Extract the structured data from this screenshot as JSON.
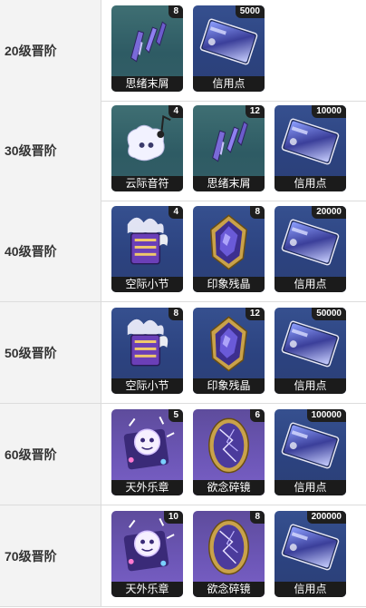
{
  "rows": [
    {
      "label": "20级晋阶",
      "items": [
        {
          "name": "思绪末屑",
          "count": "8",
          "icon": "thought-shard-icon",
          "bg": "green"
        },
        {
          "name": "信用点",
          "count": "5000",
          "icon": "credit-card-icon",
          "bg": "blue"
        }
      ]
    },
    {
      "label": "30级晋阶",
      "items": [
        {
          "name": "云际音符",
          "count": "4",
          "icon": "cloud-note-icon",
          "bg": "green"
        },
        {
          "name": "思绪末屑",
          "count": "12",
          "icon": "thought-shard-icon",
          "bg": "green"
        },
        {
          "name": "信用点",
          "count": "10000",
          "icon": "credit-card-icon",
          "bg": "blue"
        }
      ]
    },
    {
      "label": "40级晋阶",
      "items": [
        {
          "name": "空际小节",
          "count": "4",
          "icon": "sky-measure-icon",
          "bg": "blue"
        },
        {
          "name": "印象残晶",
          "count": "8",
          "icon": "impression-crystal-icon",
          "bg": "blue"
        },
        {
          "name": "信用点",
          "count": "20000",
          "icon": "credit-card-icon",
          "bg": "blue"
        }
      ]
    },
    {
      "label": "50级晋阶",
      "items": [
        {
          "name": "空际小节",
          "count": "8",
          "icon": "sky-measure-icon",
          "bg": "blue"
        },
        {
          "name": "印象残晶",
          "count": "12",
          "icon": "impression-crystal-icon",
          "bg": "blue"
        },
        {
          "name": "信用点",
          "count": "50000",
          "icon": "credit-card-icon",
          "bg": "blue"
        }
      ]
    },
    {
      "label": "60级晋阶",
      "items": [
        {
          "name": "天外乐章",
          "count": "5",
          "icon": "celestial-movement-icon",
          "bg": "purple"
        },
        {
          "name": "欲念碎镜",
          "count": "6",
          "icon": "desire-mirror-icon",
          "bg": "purple"
        },
        {
          "name": "信用点",
          "count": "100000",
          "icon": "credit-card-icon",
          "bg": "blue"
        }
      ]
    },
    {
      "label": "70级晋阶",
      "items": [
        {
          "name": "天外乐章",
          "count": "10",
          "icon": "celestial-movement-icon",
          "bg": "purple"
        },
        {
          "name": "欲念碎镜",
          "count": "8",
          "icon": "desire-mirror-icon",
          "bg": "purple"
        },
        {
          "name": "信用点",
          "count": "200000",
          "icon": "credit-card-icon",
          "bg": "blue"
        }
      ]
    }
  ]
}
